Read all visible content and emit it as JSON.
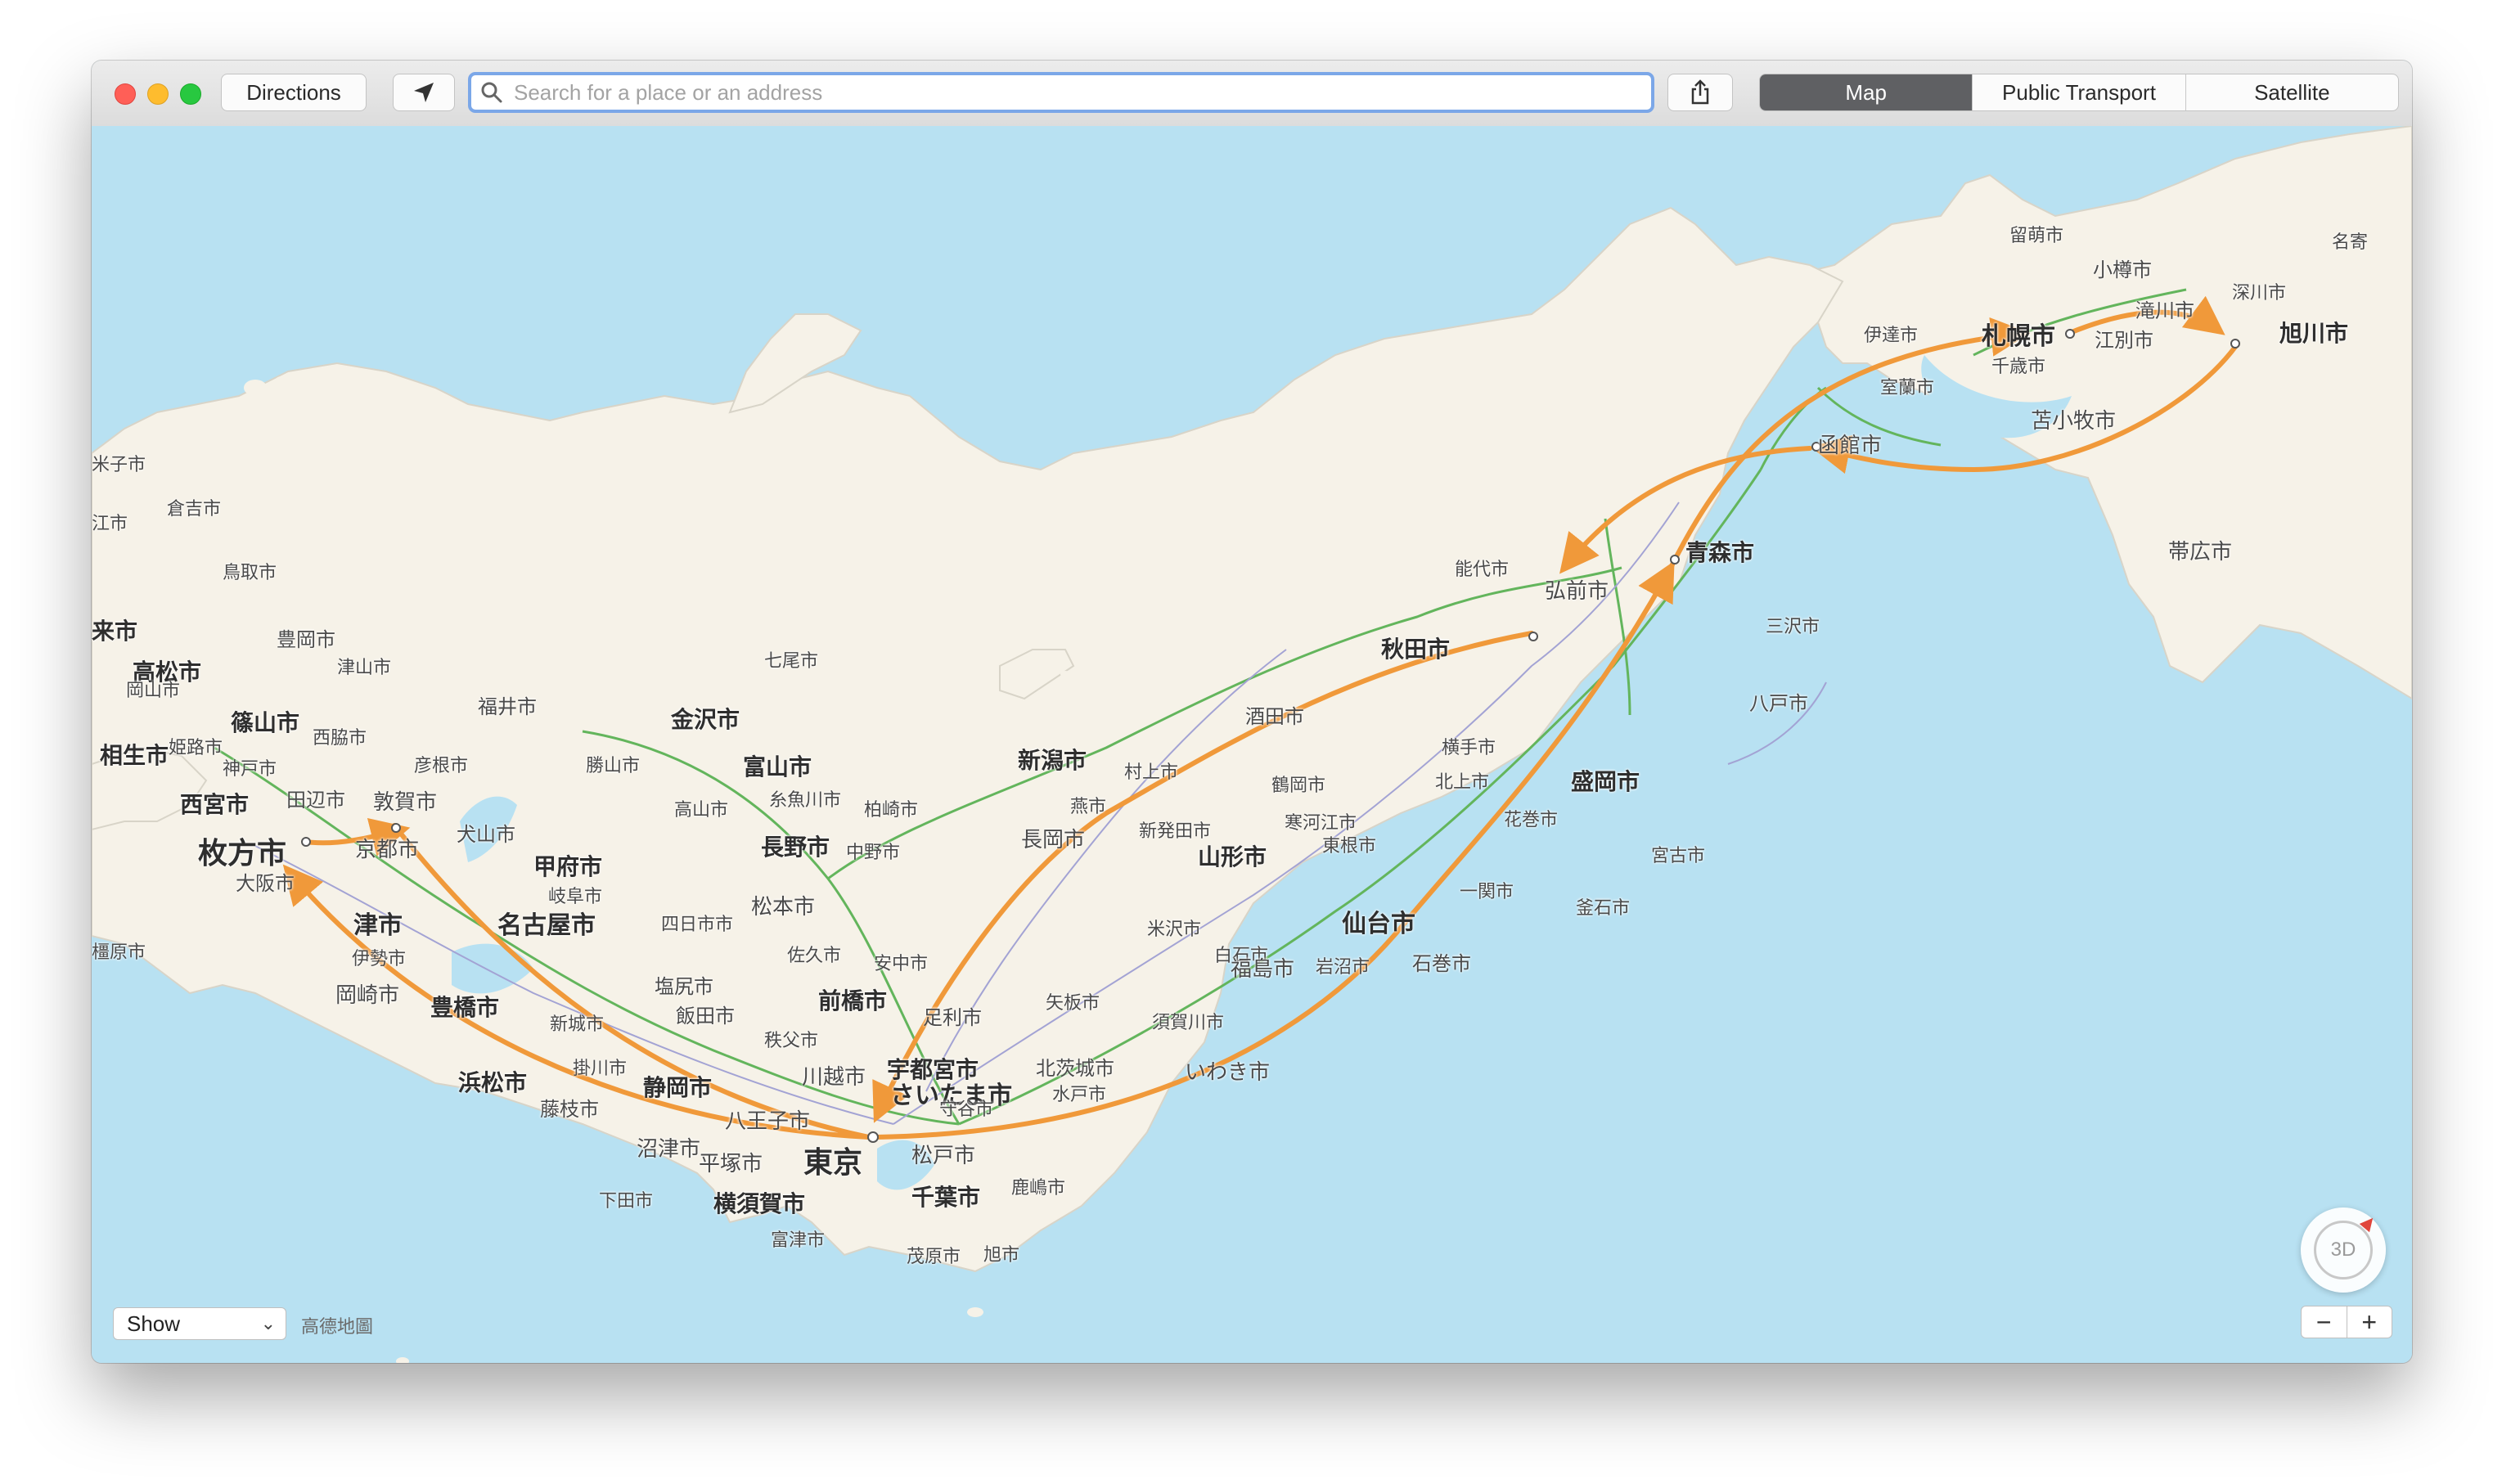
{
  "toolbar": {
    "directions_label": "Directions",
    "search_placeholder": "Search for a place or an address",
    "map_types": [
      "Map",
      "Public Transport",
      "Satellite"
    ],
    "active_map_type": "Map"
  },
  "map": {
    "attribution": "高德地圖",
    "show_select": "Show",
    "compass_label": "3D",
    "zoom_out": "−",
    "zoom_in": "+",
    "colors": {
      "water": "#b8e1f2",
      "land": "#f6f2e8",
      "route": "#f0993a",
      "rail": "#63b55c",
      "road": "#a3a3d4"
    },
    "places": [
      {
        "name": "留萌市"
      },
      {
        "name": "名寄"
      },
      {
        "name": "小樽市"
      },
      {
        "name": "深川市"
      },
      {
        "name": "滝川市"
      },
      {
        "name": "旭川市"
      },
      {
        "name": "伊達市"
      },
      {
        "name": "札幌市"
      },
      {
        "name": "江別市"
      },
      {
        "name": "千歳市"
      },
      {
        "name": "室蘭市"
      },
      {
        "name": "苫小牧市"
      },
      {
        "name": "函館市"
      },
      {
        "name": "帯広市"
      },
      {
        "name": "能代市"
      },
      {
        "name": "青森市"
      },
      {
        "name": "弘前市"
      },
      {
        "name": "三沢市"
      },
      {
        "name": "秋田市"
      },
      {
        "name": "八戸市"
      },
      {
        "name": "酒田市"
      },
      {
        "name": "横手市"
      },
      {
        "name": "北上市"
      },
      {
        "name": "盛岡市"
      },
      {
        "name": "鶴岡市"
      },
      {
        "name": "新潟市"
      },
      {
        "name": "村上市"
      },
      {
        "name": "花巻市"
      },
      {
        "name": "寒河江市"
      },
      {
        "name": "東根市"
      },
      {
        "name": "山形市"
      },
      {
        "name": "宮古市"
      },
      {
        "name": "一関市"
      },
      {
        "name": "釜石市"
      },
      {
        "name": "仙台市"
      },
      {
        "name": "米沢市"
      },
      {
        "name": "白石市"
      },
      {
        "name": "石巻市"
      },
      {
        "name": "岩沼市"
      },
      {
        "name": "福島市"
      },
      {
        "name": "新発田市"
      },
      {
        "name": "燕市"
      },
      {
        "name": "長岡市"
      },
      {
        "name": "柏崎市"
      },
      {
        "name": "七尾市"
      },
      {
        "name": "金沢市"
      },
      {
        "name": "富山市"
      },
      {
        "name": "糸魚川市"
      },
      {
        "name": "勝山市"
      },
      {
        "name": "高山市"
      },
      {
        "name": "福井市"
      },
      {
        "name": "長野市"
      },
      {
        "name": "中野市"
      },
      {
        "name": "松本市"
      },
      {
        "name": "安中市"
      },
      {
        "name": "佐久市"
      },
      {
        "name": "前橋市"
      },
      {
        "name": "矢板市"
      },
      {
        "name": "足利市"
      },
      {
        "name": "須賀川市"
      },
      {
        "name": "宇都宮市"
      },
      {
        "name": "北茨城市"
      },
      {
        "name": "いわき市"
      },
      {
        "name": "秩父市"
      },
      {
        "name": "川越市"
      },
      {
        "name": "さいたま市"
      },
      {
        "name": "水戸市"
      },
      {
        "name": "守谷市"
      },
      {
        "name": "八王子市"
      },
      {
        "name": "東京"
      },
      {
        "name": "松戸市"
      },
      {
        "name": "鹿嶋市"
      },
      {
        "name": "平塚市"
      },
      {
        "name": "千葉市"
      },
      {
        "name": "横須賀市"
      },
      {
        "name": "富津市"
      },
      {
        "name": "旭市"
      },
      {
        "name": "茂原市"
      },
      {
        "name": "沼津市"
      },
      {
        "name": "下田市"
      },
      {
        "name": "静岡市"
      },
      {
        "name": "藤枝市"
      },
      {
        "name": "掛川市"
      },
      {
        "name": "浜松市"
      },
      {
        "name": "新城市"
      },
      {
        "name": "豊橋市"
      },
      {
        "name": "岡崎市"
      },
      {
        "name": "伊勢市"
      },
      {
        "name": "津市"
      },
      {
        "name": "名古屋市"
      },
      {
        "name": "四日市市"
      },
      {
        "name": "塩尻市"
      },
      {
        "name": "飯田市"
      },
      {
        "name": "甲府市"
      },
      {
        "name": "岐阜市"
      },
      {
        "name": "犬山市"
      },
      {
        "name": "彦根市"
      },
      {
        "name": "敦賀市"
      },
      {
        "name": "京都市"
      },
      {
        "name": "枚方市"
      },
      {
        "name": "大阪市"
      },
      {
        "name": "橿原市"
      },
      {
        "name": "田辺市"
      },
      {
        "name": "西宮市"
      },
      {
        "name": "神戸市"
      },
      {
        "name": "西脇市"
      },
      {
        "name": "篠山市"
      },
      {
        "name": "姫路市"
      },
      {
        "name": "相生市"
      },
      {
        "name": "高松市"
      },
      {
        "name": "岡山市"
      },
      {
        "name": "津山市"
      },
      {
        "name": "豊岡市"
      },
      {
        "name": "鳥取市"
      },
      {
        "name": "倉吉市"
      },
      {
        "name": "米子市"
      },
      {
        "name": "江市"
      },
      {
        "name": "来市"
      },
      {
        "name": "市"
      }
    ]
  }
}
